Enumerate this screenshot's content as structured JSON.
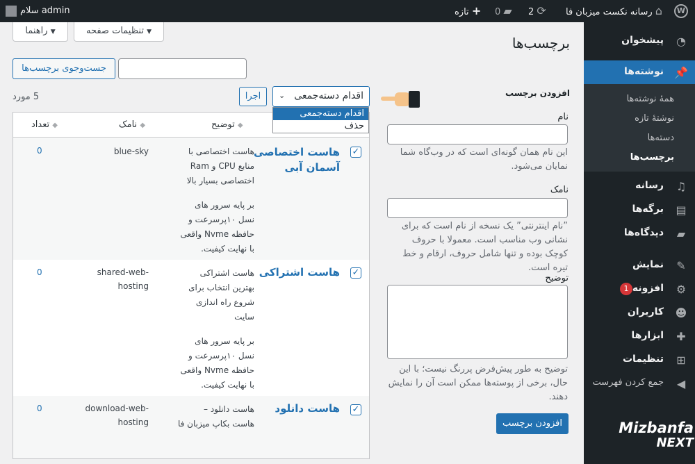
{
  "admin_bar": {
    "greeting": "سلام admin",
    "site_name": "رسانه نکست میزبان فا",
    "updates_count": "2",
    "comments_count": "0",
    "new_label": "تازه"
  },
  "sidebar": {
    "items": [
      {
        "label": "پیشخوان",
        "icon": "dashboard-icon"
      },
      {
        "label": "نوشته‌ها",
        "icon": "pin-icon"
      },
      {
        "label": "رسانه",
        "icon": "media-icon"
      },
      {
        "label": "برگه‌ها",
        "icon": "pages-icon"
      },
      {
        "label": "دیدگاه‌ها",
        "icon": "comments-icon"
      },
      {
        "label": "نمایش",
        "icon": "appearance-icon"
      },
      {
        "label": "افزونه‌ها",
        "icon": "plugins-icon",
        "badge": "1"
      },
      {
        "label": "کاربران",
        "icon": "users-icon"
      },
      {
        "label": "ابزارها",
        "icon": "tools-icon"
      },
      {
        "label": "تنظیمات",
        "icon": "settings-icon"
      },
      {
        "label": "جمع کردن فهرست",
        "icon": "collapse-icon"
      }
    ],
    "submenu": [
      "همهٔ نوشته‌ها",
      "نوشتهٔ تازه",
      "دسته‌ها",
      "برچسب‌ها"
    ]
  },
  "header": {
    "page_title": "برچسب‌ها",
    "screen_options": "تنظیمات صفحه",
    "help": "راهنما"
  },
  "search": {
    "button": "جست‌وجوی برچسب‌ها",
    "value": ""
  },
  "bulk": {
    "selected": "اقدام دسته‌جمعی",
    "apply": "اجرا",
    "options": [
      "اقدام دسته‌جمعی",
      "حذف"
    ],
    "items_count": "5 مورد"
  },
  "add_form": {
    "heading": "افزودن برچسب",
    "name_label": "نام",
    "name_value": "",
    "name_desc": "این نام همان گونه‌ای است که در وب‌گاه شما نمایان می‌شود.",
    "slug_label": "نامک",
    "slug_value": "",
    "slug_desc": "”نام اینترنتی” یک نسخه از نام است که برای نشانی وب مناسب است. معمولا با حروف کوچک بوده و تنها شامل حروف، ارقام و خط تیره است.",
    "desc_label": "توضیح",
    "desc_value": "",
    "desc_desc": "توضیح به طور پیش‌فرض پررنگ نیست؛ با این حال، برخی از پوسته‌ها ممکن است آن را نمایش دهند.",
    "submit": "افزودن برچسب"
  },
  "table": {
    "columns": {
      "name": "نام",
      "description": "توضیح",
      "slug": "نامک",
      "count": "تعداد"
    },
    "rows": [
      {
        "name_lines": [
          "هاست اختصاصی",
          "آسمان آبی"
        ],
        "desc_lines": [
          "هاست اختصاصی با",
          "منابع CPU و Ram",
          "اختصاصی بسیار بالا",
          "",
          "بر پایه سرور های",
          "نسل ۱۰پرسرعت و",
          "حافظه Nvme واقعی",
          "با نهایت کیفیت."
        ],
        "slug_lines": [
          "blue-sky"
        ],
        "count": "0"
      },
      {
        "name_lines": [
          "هاست اشتراکی"
        ],
        "desc_lines": [
          "هاست اشتراکی",
          "بهترین انتخاب برای",
          "شروع راه اندازی",
          "سایت",
          "",
          "بر پایه سرور های",
          "نسل ۱۰پرسرعت و",
          "حافظه Nvme واقعی",
          "با نهایت کیفیت."
        ],
        "slug_lines": [
          "shared-web-",
          "hosting"
        ],
        "count": "0"
      },
      {
        "name_lines": [
          "هاست دانلود"
        ],
        "desc_lines": [
          "هاست دانلود –",
          "هاست بکاپ میزبان فا"
        ],
        "slug_lines": [
          "download-web-",
          "hosting"
        ],
        "count": "0"
      }
    ]
  },
  "watermark": {
    "line1": "Mizbanfa",
    "line2": "NEXT"
  }
}
